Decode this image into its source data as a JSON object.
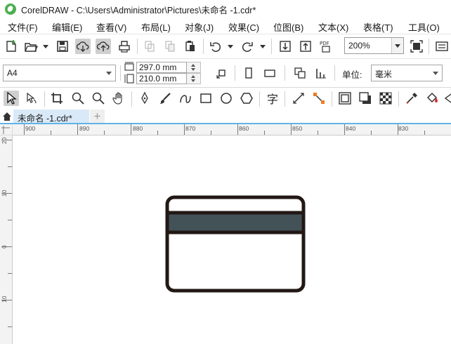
{
  "window": {
    "title": "CorelDRAW - C:\\Users\\Administrator\\Pictures\\未命名 -1.cdr*"
  },
  "menu": [
    "文件(F)",
    "编辑(E)",
    "查看(V)",
    "布局(L)",
    "对象(J)",
    "效果(C)",
    "位图(B)",
    "文本(X)",
    "表格(T)",
    "工具(O)"
  ],
  "standard_toolbar": {
    "zoom_value": "200%",
    "pdf_label": "PDF"
  },
  "property_bar": {
    "paper_size": "A4",
    "width": "297.0 mm",
    "height": "210.0 mm",
    "units_label": "单位:",
    "units_value": "毫米"
  },
  "toolbox": {
    "text_tool_glyph": "字"
  },
  "document_tabs": {
    "active": "未命名 -1.cdr*",
    "add": "+"
  },
  "rulers": {
    "horizontal": [
      "900",
      "890",
      "880",
      "870",
      "860",
      "850",
      "840",
      "830"
    ],
    "vertical": [
      "20",
      "10",
      "0",
      "10"
    ]
  },
  "canvas": {
    "shape": "credit-card",
    "stroke_color": "#231815",
    "stripe_color": "#435257",
    "fill_color": "#ffffff"
  }
}
